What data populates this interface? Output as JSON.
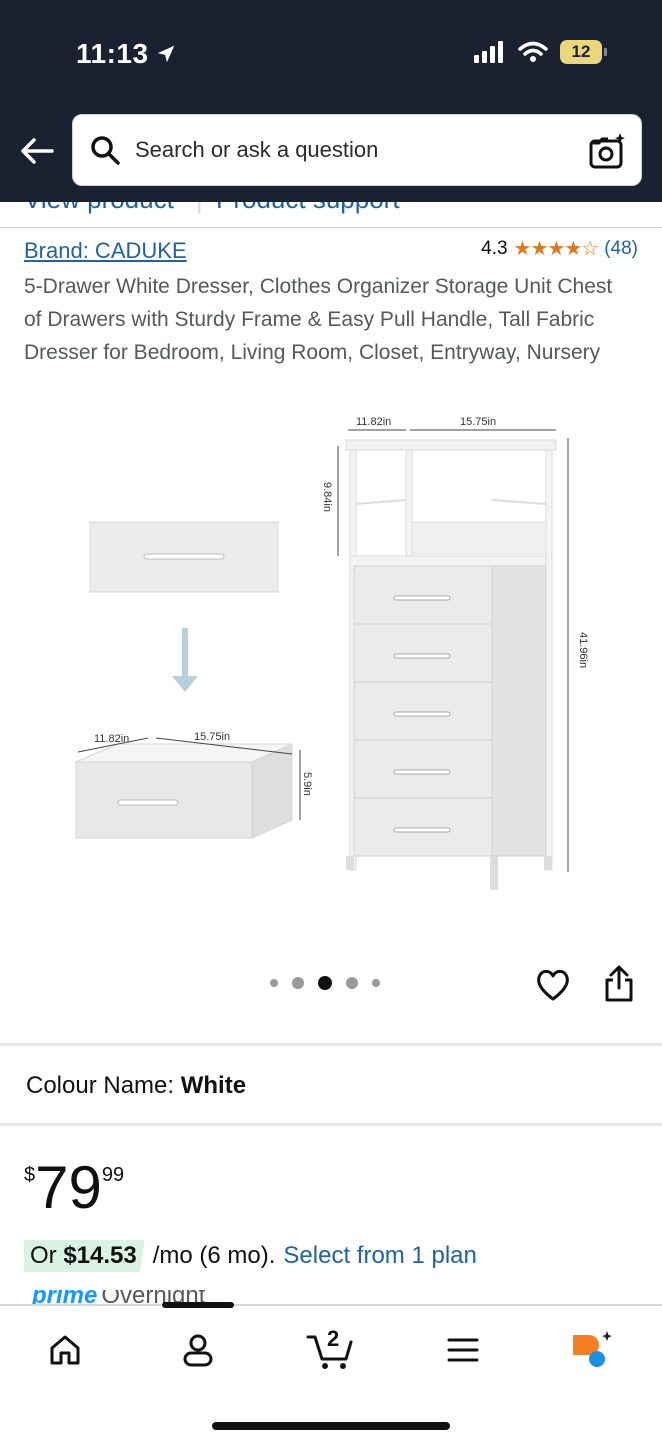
{
  "status": {
    "time": "11:13",
    "battery": "12"
  },
  "search": {
    "placeholder": "Search or ask a question"
  },
  "tabs_remnant": {
    "left": "View product",
    "right": "Product support"
  },
  "product": {
    "brand": "Brand: CADUKE",
    "rating": "4.3",
    "rating_count": "(48)",
    "stars": "★★★★☆",
    "title": "5-Drawer White Dresser, Clothes Organizer Storage Unit Chest of Drawers with Sturdy Frame & Easy Pull Handle, Tall Fabric Dresser for Bedroom, Living Room, Closet, Entryway, Nursery"
  },
  "image_dims": {
    "depth_top": "11.82in",
    "width_top": "15.75in",
    "shelf_height": "9.84in",
    "total_height": "41.96in",
    "drawer_depth": "11.82in",
    "drawer_width": "15.75in",
    "drawer_height": "5.9in"
  },
  "carousel": {
    "count": 5,
    "active": 3
  },
  "colour": {
    "label": "Colour Name:",
    "value": "White"
  },
  "price": {
    "symbol": "$",
    "whole": "79",
    "fraction": "99"
  },
  "plan": {
    "or": "Or ",
    "amount": "$14.53",
    "per": "/mo (6 mo).",
    "link": "Select from 1 plan"
  },
  "prime": {
    "label": "prime",
    "overnight": "Overnight"
  },
  "nav": {
    "cart_count": "2"
  },
  "colors": {
    "header_bg": "#1a2130",
    "link": "#2162a1",
    "star": "#de7921",
    "plan_badge": "#d9f2e3"
  }
}
